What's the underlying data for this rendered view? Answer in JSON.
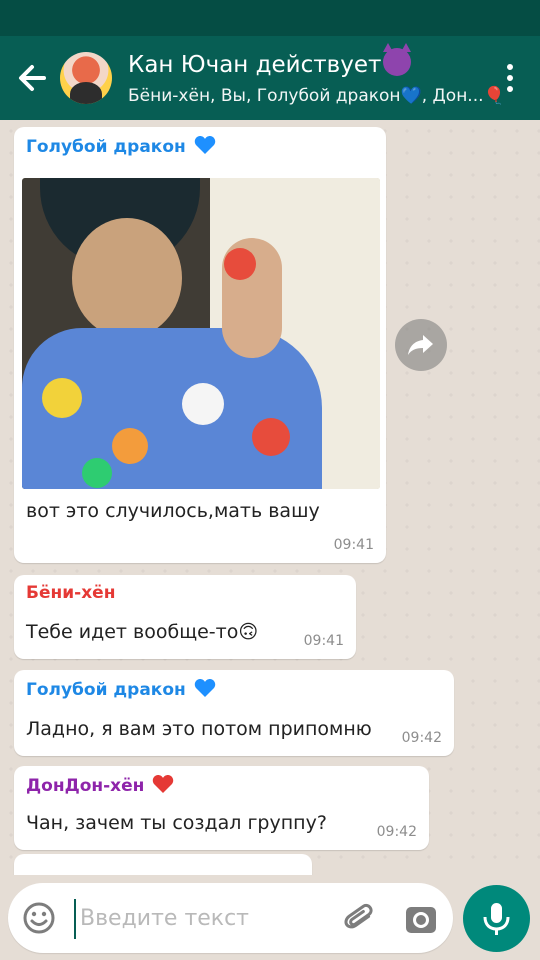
{
  "header": {
    "title": "Кан Ючан действует",
    "subtitle": "Бёни-хён, Вы, Голубой дракон💙, Дон...🎈"
  },
  "icons": {
    "back": "arrow-left-icon",
    "menu": "more-vert-icon",
    "forward": "forward-icon",
    "emoji": "smiley-icon",
    "attach": "paperclip-icon",
    "camera": "camera-icon",
    "mic": "mic-icon"
  },
  "colors": {
    "appbar": "#075e54",
    "statusbar": "#054d44",
    "mic_button": "#00897b",
    "sender_blue": "#1e88e5",
    "sender_red": "#e53935",
    "sender_purple": "#8e24aa"
  },
  "messages": [
    {
      "sender": "Голубой дракон",
      "text": "вот это случилось,мать вашу",
      "time": "09:41",
      "has_image": true
    },
    {
      "sender": "Бёни-хён",
      "text": "Тебе идет вообще-то🙃",
      "time": "09:41"
    },
    {
      "sender": "Голубой дракон",
      "text": "Ладно, я вам это потом припомню",
      "time": "09:42"
    },
    {
      "sender": "ДонДон-хён",
      "text": "Чан, зачем ты создал группу?",
      "time": "09:42"
    }
  ],
  "input": {
    "placeholder": "Введите текст"
  }
}
